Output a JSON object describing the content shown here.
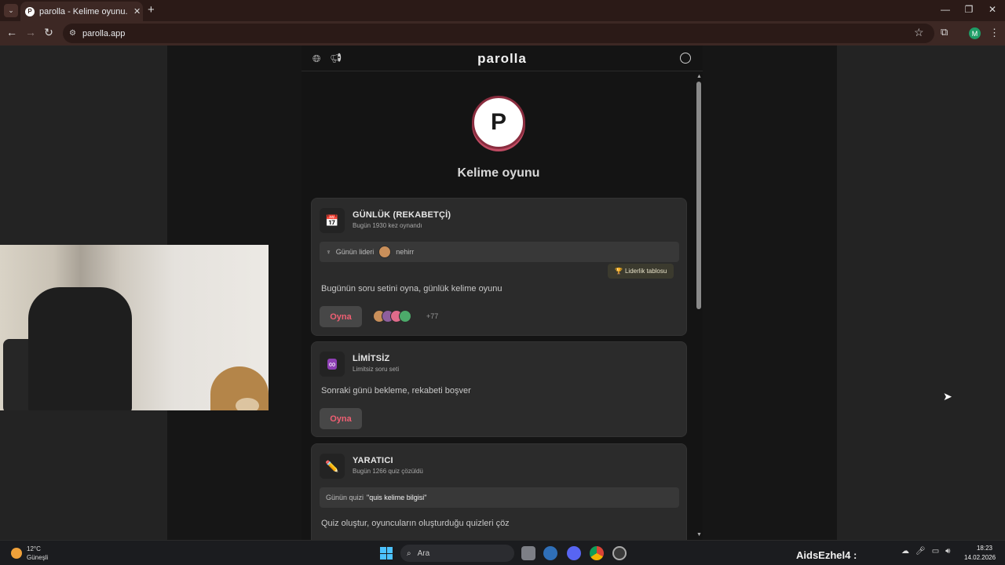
{
  "browser": {
    "tab_title": "parolla - Kelime oyunu. Günlük",
    "tab_favicon": "P",
    "url": "parolla.app",
    "profile_initial": "M"
  },
  "app": {
    "brand": "parolla",
    "logo_letter": "P",
    "title": "Kelime oyunu",
    "accent_color": "#f05f73"
  },
  "cards": {
    "daily": {
      "title": "GÜNLÜK (REKABETÇİ)",
      "subtitle": "Bugün 1930 kez oynandı",
      "leader_label": "Günün lideri",
      "leader_name": "nehirr",
      "leaderboard_button": "Liderlik tablosu",
      "description": "Bugünün soru setini oyna, günlük kelime oyunu",
      "play_label": "Oyna",
      "more_players": "+77"
    },
    "unlimited": {
      "title": "LİMİTSİZ",
      "subtitle": "Limitsiz soru seti",
      "description": "Sonraki günü bekleme, rekabeti boşver",
      "play_label": "Oyna"
    },
    "creative": {
      "title": "YARATICI",
      "subtitle": "Bugün 1266 quiz çözüldü",
      "quiz_label": "Günün quizi",
      "quiz_name": "\"quis kelime bilgisi\"",
      "description": "Quiz oluştur, oyuncuların oluşturduğu quizleri çöz"
    }
  },
  "taskbar": {
    "weather_temp": "12°C",
    "weather_desc": "Güneşli",
    "search_placeholder": "Ara",
    "overlay_text": "AidsEzhel4 :",
    "time": "18:23",
    "date": "14.02.2026"
  }
}
